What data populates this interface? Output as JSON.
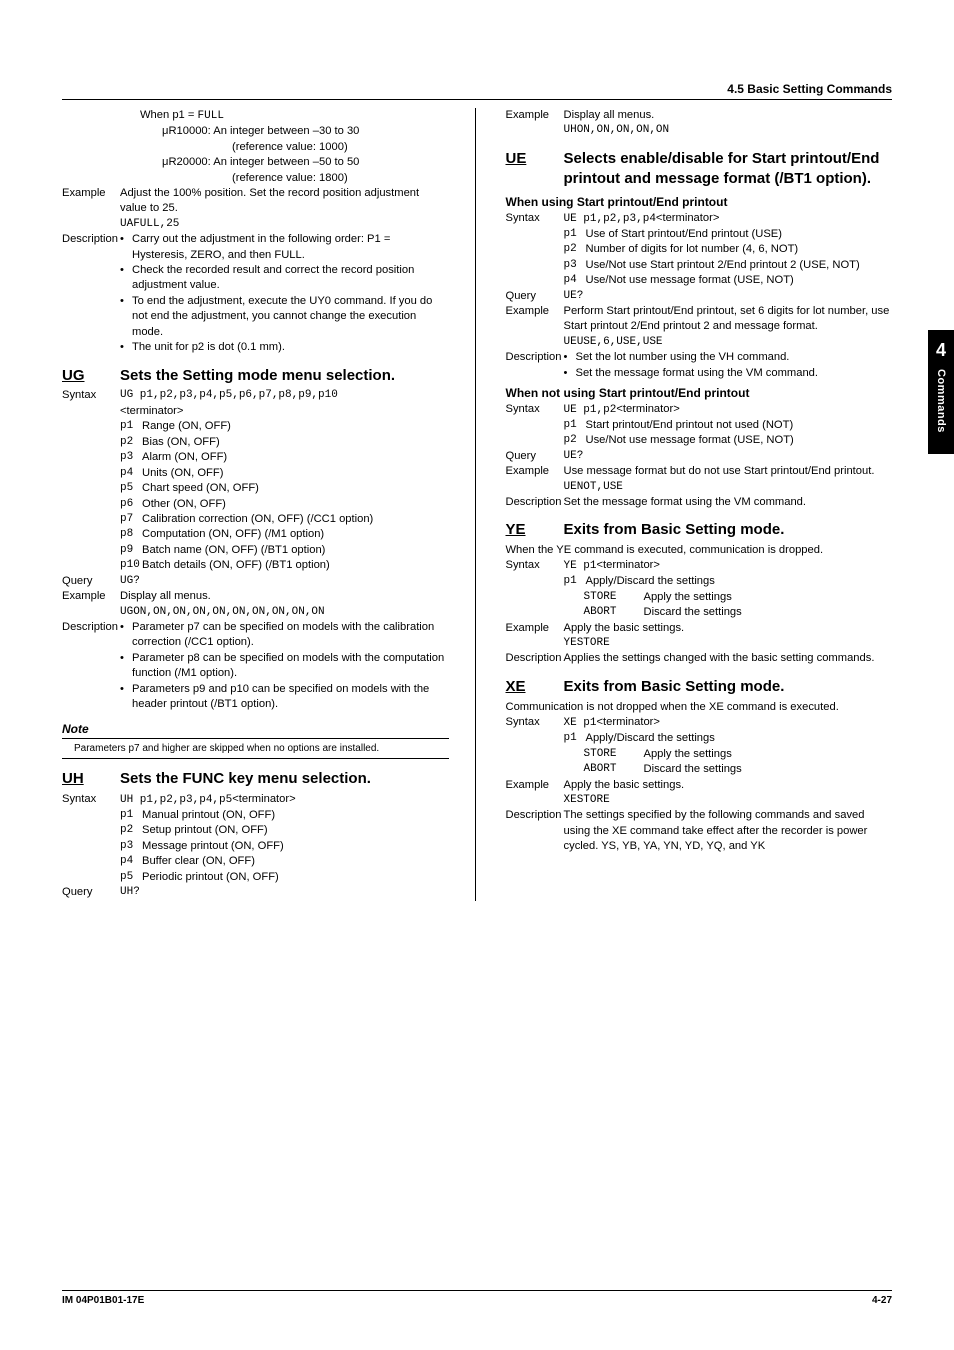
{
  "header": {
    "section": "4.5  Basic Setting Commands"
  },
  "side": {
    "num": "4",
    "label": "Commands"
  },
  "footer": {
    "left": "IM 04P01B01-17E",
    "right": "4-27"
  },
  "left": {
    "when_full": "When p1 = ",
    "when_full_code": "FULL",
    "r1": "μR10000: An integer between –30 to 30",
    "r1ref": "(reference value: 1000)",
    "r2": "μR20000: An integer between –50 to 50",
    "r2ref": "(reference value: 1800)",
    "ex_lbl": "Example",
    "ex_txt": "Adjust the 100% position. Set the record position adjustment value to 25.",
    "ex_code": "UAFULL,25",
    "desc_lbl": "Description",
    "d1": "Carry out the adjustment in the following order: P1 = Hysteresis, ZERO, and then FULL.",
    "d2": "Check the recorded result and correct the record position adjustment value.",
    "d3": "To end the adjustment, execute the UY0 command. If you do not end the adjustment, you cannot change the execution mode.",
    "d4": "The unit for p2 is dot (0.1 mm).",
    "ug_code": "UG",
    "ug_title": "Sets the Setting mode menu selection.",
    "ug_syn_lbl": "Syntax",
    "ug_syn_code": "UG p1,p2,p3,p4,p5,p6,p7,p8,p9,p10",
    "ug_term": "<terminator>",
    "ug_p1": "Range (ON, OFF)",
    "ug_p2": "Bias (ON, OFF)",
    "ug_p3": "Alarm (ON, OFF)",
    "ug_p4": "Units (ON, OFF)",
    "ug_p5": "Chart speed (ON, OFF)",
    "ug_p6": "Other (ON, OFF)",
    "ug_p7": "Calibration correction (ON, OFF) (/CC1 option)",
    "ug_p8": "Computation (ON, OFF) (/M1 option)",
    "ug_p9": "Batch name (ON, OFF) (/BT1 option)",
    "ug_p10": "Batch details (ON, OFF) (/BT1 option)",
    "ug_q_lbl": "Query",
    "ug_q_code": "UG?",
    "ug_ex_lbl": "Example",
    "ug_ex_txt": "Display all menus.",
    "ug_ex_code": "UGON,ON,ON,ON,ON,ON,ON,ON,ON,ON",
    "ug_d_lbl": "Description",
    "ug_d1": "Parameter p7 can be specified on models with the calibration correction (/CC1 option).",
    "ug_d2": "Parameter p8 can be specified on models with the computation function (/M1 option).",
    "ug_d3": "Parameters p9 and p10 can be specified on models with the header printout (/BT1 option).",
    "note_head": "Note",
    "note_txt": "Parameters p7 and higher are skipped when no options are installed.",
    "uh_code": "UH",
    "uh_title": "Sets the FUNC key menu selection.",
    "uh_syn_lbl": "Syntax",
    "uh_syn_code": "UH p1,p2,p3,p4,p5",
    "uh_p1": "Manual printout (ON, OFF)",
    "uh_p2": "Setup printout (ON, OFF)",
    "uh_p3": "Message printout (ON, OFF)",
    "uh_p4": "Buffer clear (ON, OFF)",
    "uh_p5": "Periodic printout (ON, OFF)",
    "uh_q_lbl": "Query",
    "uh_q_code": "UH?"
  },
  "right": {
    "uh_ex_lbl": "Example",
    "uh_ex_txt": "Display all menus.",
    "uh_ex_code": "UHON,ON,ON,ON,ON",
    "ue_code": "UE",
    "ue_title": "Selects enable/disable for Start printout/End printout and message format (/BT1 option).",
    "ue_sub1": "When using Start printout/End printout",
    "ue_syn_lbl": "Syntax",
    "ue_syn_code": "UE p1,p2,p3,p4",
    "term": "<terminator>",
    "ue_p1": "Use of Start printout/End printout (USE)",
    "ue_p2": "Number of digits for lot number (4, 6, NOT)",
    "ue_p3": "Use/Not use Start printout 2/End printout 2 (USE, NOT)",
    "ue_p4": "Use/Not use message format (USE, NOT)",
    "ue_q_lbl": "Query",
    "ue_q_code": "UE?",
    "ue_ex_lbl": "Example",
    "ue_ex_txt": "Perform Start printout/End printout, set 6 digits for lot number, use Start printout 2/End printout 2 and message format.",
    "ue_ex_code": "UEUSE,6,USE,USE",
    "ue_d_lbl": "Description",
    "ue_d1": "Set the lot number using the VH command.",
    "ue_d2": "Set the message format using the VM command.",
    "ue_sub2": "When not using Start printout/End printout",
    "ue2_syn_code": "UE p1,p2",
    "ue2_p1": "Start printout/End printout not used (NOT)",
    "ue2_p2": "Use/Not use message format (USE, NOT)",
    "ue2_ex_txt": "Use message format but do not use Start printout/End printout.",
    "ue2_ex_code": "UENOT,USE",
    "ue2_d": "Set the message format using the VM command.",
    "ye_code": "YE",
    "ye_title": "Exits from Basic Setting mode.",
    "ye_intro": "When the YE command is executed, communication is dropped.",
    "ye_syn_code": "YE p1",
    "ye_p1": "Apply/Discard the settings",
    "ye_store": "STORE",
    "ye_store_txt": "Apply the settings",
    "ye_abort": "ABORT",
    "ye_abort_txt": "Discard the settings",
    "ye_ex_txt": "Apply the basic settings.",
    "ye_ex_code": "YESTORE",
    "ye_d": "Applies the settings changed with the basic setting commands.",
    "xe_code": "XE",
    "xe_title": "Exits from Basic Setting mode.",
    "xe_intro": "Communication is not dropped when the XE command is executed.",
    "xe_syn_code": "XE p1",
    "xe_ex_code": "XESTORE",
    "xe_d": "The settings specified by the following commands and saved using the XE command take effect after the recorder is power cycled. YS, YB, YA, YN, YD, YQ, and YK"
  }
}
